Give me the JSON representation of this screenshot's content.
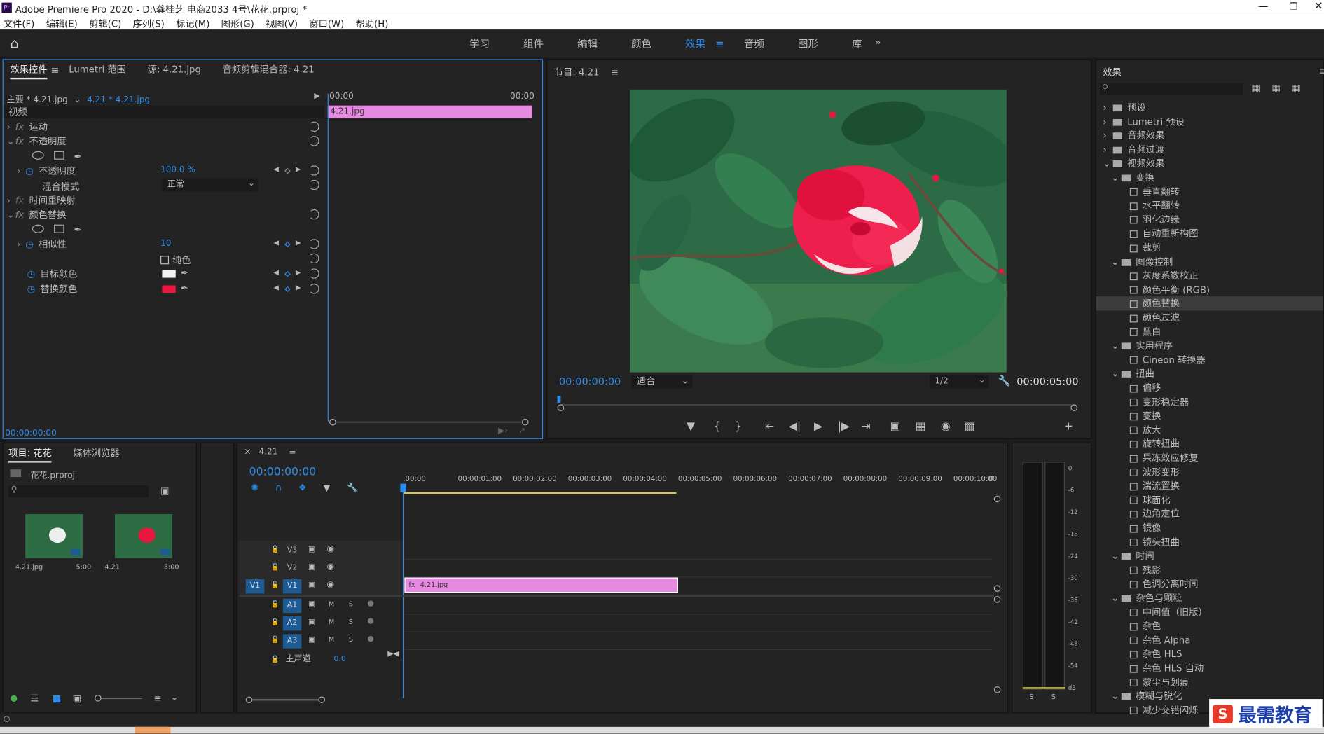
{
  "titlebar": {
    "app_icon": "Pr",
    "title": "Adobe Premiere Pro 2020 - D:\\龚桂芝 电商2033 4号\\花花.prproj *"
  },
  "menu": [
    "文件(F)",
    "编辑(E)",
    "剪辑(C)",
    "序列(S)",
    "标记(M)",
    "图形(G)",
    "视图(V)",
    "窗口(W)",
    "帮助(H)"
  ],
  "workspaces": [
    "学习",
    "组件",
    "编辑",
    "颜色",
    "效果",
    "音频",
    "图形",
    "库"
  ],
  "workspace_active": "效果",
  "effect_controls": {
    "tabs": [
      "效果控件",
      "Lumetri 范围",
      "源: 4.21.jpg",
      "音频剪辑混合器: 4.21"
    ],
    "master": "主要 * 4.21.jpg",
    "clip": "4.21 * 4.21.jpg",
    "time_start": "00:00",
    "time_end": "00:00",
    "clip_label": "4.21.jpg",
    "section": "视频",
    "motion": "运动",
    "opacity": "不透明度",
    "opacity_param": "不透明度",
    "opacity_value": "100.0 %",
    "blend_label": "混合模式",
    "blend_value": "正常",
    "time_remap": "时间重映射",
    "color_replace": "颜色替换",
    "similarity": "相似性",
    "similarity_value": "10",
    "solid": "纯色",
    "target": "目标颜色",
    "replace": "替换颜色",
    "target_color": "#f2f2f2",
    "replace_color": "#e8173f",
    "timecode": "00:00:00:00"
  },
  "program": {
    "title": "节目: 4.21",
    "timecode": "00:00:00:00",
    "fit": "适合",
    "quality": "1/2",
    "duration": "00:00:05:00"
  },
  "effects": {
    "title": "效果",
    "items": [
      {
        "label": "预设",
        "lvl": 0,
        "kind": "folder"
      },
      {
        "label": "Lumetri 预设",
        "lvl": 0,
        "kind": "folder"
      },
      {
        "label": "音频效果",
        "lvl": 0,
        "kind": "folder"
      },
      {
        "label": "音频过渡",
        "lvl": 0,
        "kind": "folder"
      },
      {
        "label": "视频效果",
        "lvl": 0,
        "kind": "folder",
        "open": true
      },
      {
        "label": "变换",
        "lvl": 1,
        "kind": "folder",
        "open": true
      },
      {
        "label": "垂直翻转",
        "lvl": 2,
        "kind": "file"
      },
      {
        "label": "水平翻转",
        "lvl": 2,
        "kind": "file"
      },
      {
        "label": "羽化边缘",
        "lvl": 2,
        "kind": "file"
      },
      {
        "label": "自动重新构图",
        "lvl": 2,
        "kind": "file"
      },
      {
        "label": "裁剪",
        "lvl": 2,
        "kind": "file"
      },
      {
        "label": "图像控制",
        "lvl": 1,
        "kind": "folder",
        "open": true
      },
      {
        "label": "灰度系数校正",
        "lvl": 2,
        "kind": "file"
      },
      {
        "label": "颜色平衡 (RGB)",
        "lvl": 2,
        "kind": "file"
      },
      {
        "label": "颜色替换",
        "lvl": 2,
        "kind": "file",
        "selected": true
      },
      {
        "label": "颜色过滤",
        "lvl": 2,
        "kind": "file"
      },
      {
        "label": "黑白",
        "lvl": 2,
        "kind": "file"
      },
      {
        "label": "实用程序",
        "lvl": 1,
        "kind": "folder",
        "open": true
      },
      {
        "label": "Cineon 转换器",
        "lvl": 2,
        "kind": "file"
      },
      {
        "label": "扭曲",
        "lvl": 1,
        "kind": "folder",
        "open": true
      },
      {
        "label": "偏移",
        "lvl": 2,
        "kind": "file"
      },
      {
        "label": "变形稳定器",
        "lvl": 2,
        "kind": "file"
      },
      {
        "label": "变换",
        "lvl": 2,
        "kind": "file"
      },
      {
        "label": "放大",
        "lvl": 2,
        "kind": "file"
      },
      {
        "label": "旋转扭曲",
        "lvl": 2,
        "kind": "file"
      },
      {
        "label": "果冻效应修复",
        "lvl": 2,
        "kind": "file"
      },
      {
        "label": "波形变形",
        "lvl": 2,
        "kind": "file"
      },
      {
        "label": "湍流置换",
        "lvl": 2,
        "kind": "file"
      },
      {
        "label": "球面化",
        "lvl": 2,
        "kind": "file"
      },
      {
        "label": "边角定位",
        "lvl": 2,
        "kind": "file"
      },
      {
        "label": "镜像",
        "lvl": 2,
        "kind": "file"
      },
      {
        "label": "镜头扭曲",
        "lvl": 2,
        "kind": "file"
      },
      {
        "label": "时间",
        "lvl": 1,
        "kind": "folder",
        "open": true
      },
      {
        "label": "残影",
        "lvl": 2,
        "kind": "file"
      },
      {
        "label": "色调分离时间",
        "lvl": 2,
        "kind": "file"
      },
      {
        "label": "杂色与颗粒",
        "lvl": 1,
        "kind": "folder",
        "open": true
      },
      {
        "label": "中间值（旧版）",
        "lvl": 2,
        "kind": "file"
      },
      {
        "label": "杂色",
        "lvl": 2,
        "kind": "file"
      },
      {
        "label": "杂色 Alpha",
        "lvl": 2,
        "kind": "file"
      },
      {
        "label": "杂色 HLS",
        "lvl": 2,
        "kind": "file"
      },
      {
        "label": "杂色 HLS 自动",
        "lvl": 2,
        "kind": "file"
      },
      {
        "label": "蒙尘与划痕",
        "lvl": 2,
        "kind": "file"
      },
      {
        "label": "模糊与锐化",
        "lvl": 1,
        "kind": "folder",
        "open": true
      },
      {
        "label": "减少交错闪烁",
        "lvl": 2,
        "kind": "file"
      }
    ]
  },
  "project": {
    "tabs": [
      "项目: 花花",
      "媒体浏览器"
    ],
    "file": "花花.prproj",
    "thumbs": [
      {
        "name": "4.21.jpg",
        "dur": "5:00"
      },
      {
        "name": "4.21",
        "dur": "5:00"
      }
    ]
  },
  "timeline": {
    "title": "4.21",
    "timecode": "00:00:00:00",
    "ruler": [
      ":00:00",
      "00:00:01:00",
      "00:00:02:00",
      "00:00:03:00",
      "00:00:04:00",
      "00:00:05:00",
      "00:00:06:00",
      "00:00:07:00",
      "00:00:08:00",
      "00:00:09:00",
      "00:00:10:00",
      "0"
    ],
    "video_tracks": [
      "V3",
      "V2",
      "V1"
    ],
    "audio_tracks": [
      "A1",
      "A2",
      "A3"
    ],
    "source_patch": "V1",
    "master_label": "主声道",
    "master_value": "0.0",
    "clip_label": "4.21.jpg"
  },
  "meter": {
    "scale": [
      "0",
      "-6",
      "-12",
      "-18",
      "-24",
      "-30",
      "-36",
      "-42",
      "-48",
      "-54",
      "dB"
    ],
    "solo": [
      "S",
      "S"
    ]
  },
  "watermark": {
    "badge": "S",
    "text": "最需教育"
  }
}
